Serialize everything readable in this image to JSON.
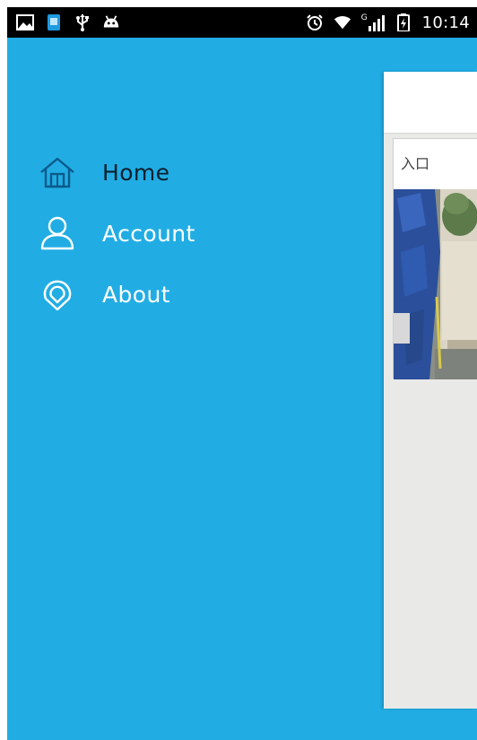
{
  "status_bar": {
    "left_icons": [
      "gallery-icon",
      "sim-app-icon",
      "usb-icon",
      "android-debug-icon"
    ],
    "right_icons": [
      "alarm-icon",
      "wifi-icon",
      "signal-icon",
      "battery-icon"
    ],
    "signal_tag": "G",
    "time": "10:14"
  },
  "drawer": {
    "background": "#21ade4",
    "items": [
      {
        "label": "Home",
        "icon": "home-icon",
        "selected": true
      },
      {
        "label": "Account",
        "icon": "account-icon",
        "selected": false
      },
      {
        "label": "About",
        "icon": "about-icon",
        "selected": false
      }
    ]
  },
  "content": {
    "card": {
      "title": "入口"
    }
  }
}
